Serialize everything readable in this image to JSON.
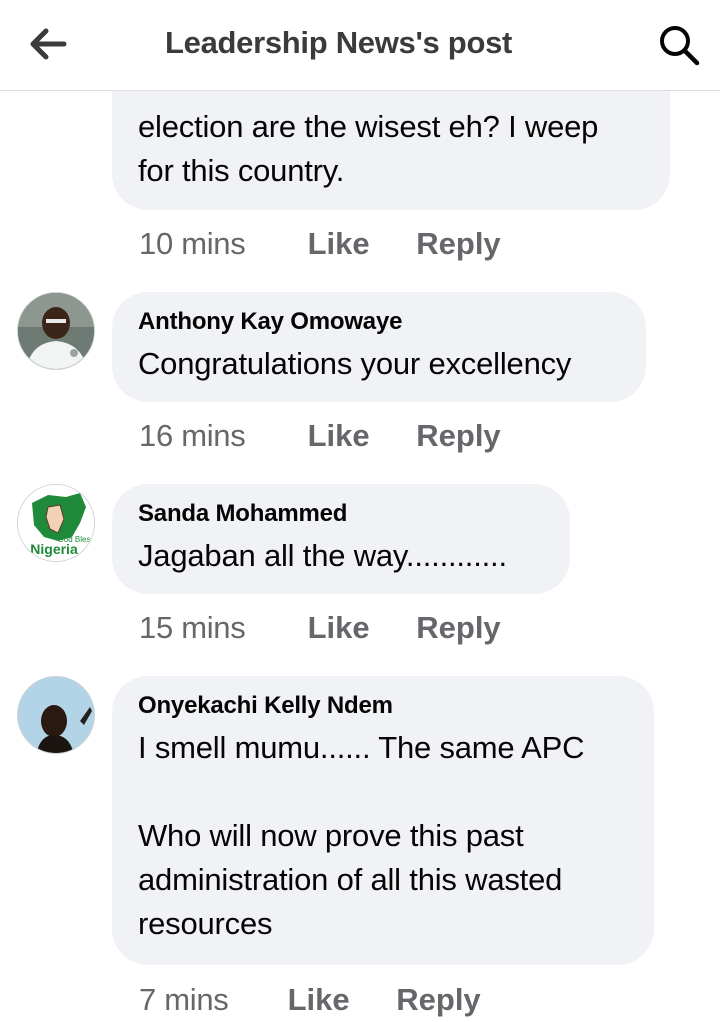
{
  "header": {
    "title": "Leadership News's post",
    "back_icon": "arrow-left-icon",
    "search_icon": "search-icon"
  },
  "colors": {
    "bubble_bg": "#f0f2f5",
    "meta_text": "#65676b",
    "title_text": "#3a3b3c"
  },
  "top_comment": {
    "text_lines": [
      "election are the wisest eh? I weep",
      "for this country."
    ],
    "time": "10 mins",
    "like_label": "Like",
    "reply_label": "Reply"
  },
  "comments": [
    {
      "author": "Anthony Kay Omowaye",
      "text": "Congratulations your excellency",
      "time": "16 mins",
      "like_label": "Like",
      "reply_label": "Reply"
    },
    {
      "author": "Sanda Mohammed",
      "text": "Jagaban all the way............",
      "time": "15 mins",
      "like_label": "Like",
      "reply_label": "Reply",
      "avatar_text": "God Bless Nigeria"
    },
    {
      "author": "Onyekachi Kelly Ndem",
      "text": "I smell mumu...... The same APC\n\nWho will now prove this past\nadministration of all this wasted\nresources",
      "time": "7 mins",
      "like_label": "Like",
      "reply_label": "Reply"
    }
  ]
}
